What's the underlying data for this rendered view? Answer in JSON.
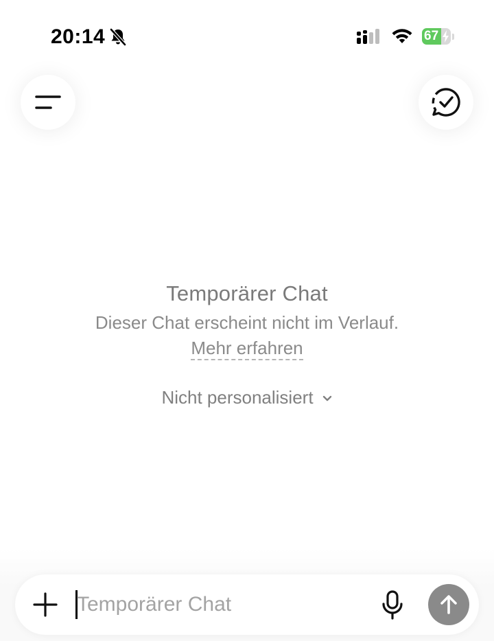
{
  "status_bar": {
    "time": "20:14",
    "battery_percent": "67",
    "battery_level": 0.67,
    "icons": [
      "bell-slash-icon",
      "signal-icon",
      "wifi-icon",
      "battery-charging-icon"
    ]
  },
  "header": {
    "menu_icon": "menu-icon",
    "temporary_chat_icon": "chat-bubble-check-icon"
  },
  "empty_state": {
    "title": "Temporärer Chat",
    "subtitle": "Dieser Chat erscheint nicht im Verlauf.",
    "learn_more": "Mehr erfahren",
    "personalization_label": "Nicht personalisiert"
  },
  "composer": {
    "placeholder": "Temporärer Chat",
    "value": "",
    "icons": [
      "plus-icon",
      "microphone-icon",
      "arrow-up-icon"
    ]
  },
  "colors": {
    "battery_green": "#5fc95d",
    "muted_text": "#7a7a7a",
    "send_button": "#8a8a8a"
  }
}
